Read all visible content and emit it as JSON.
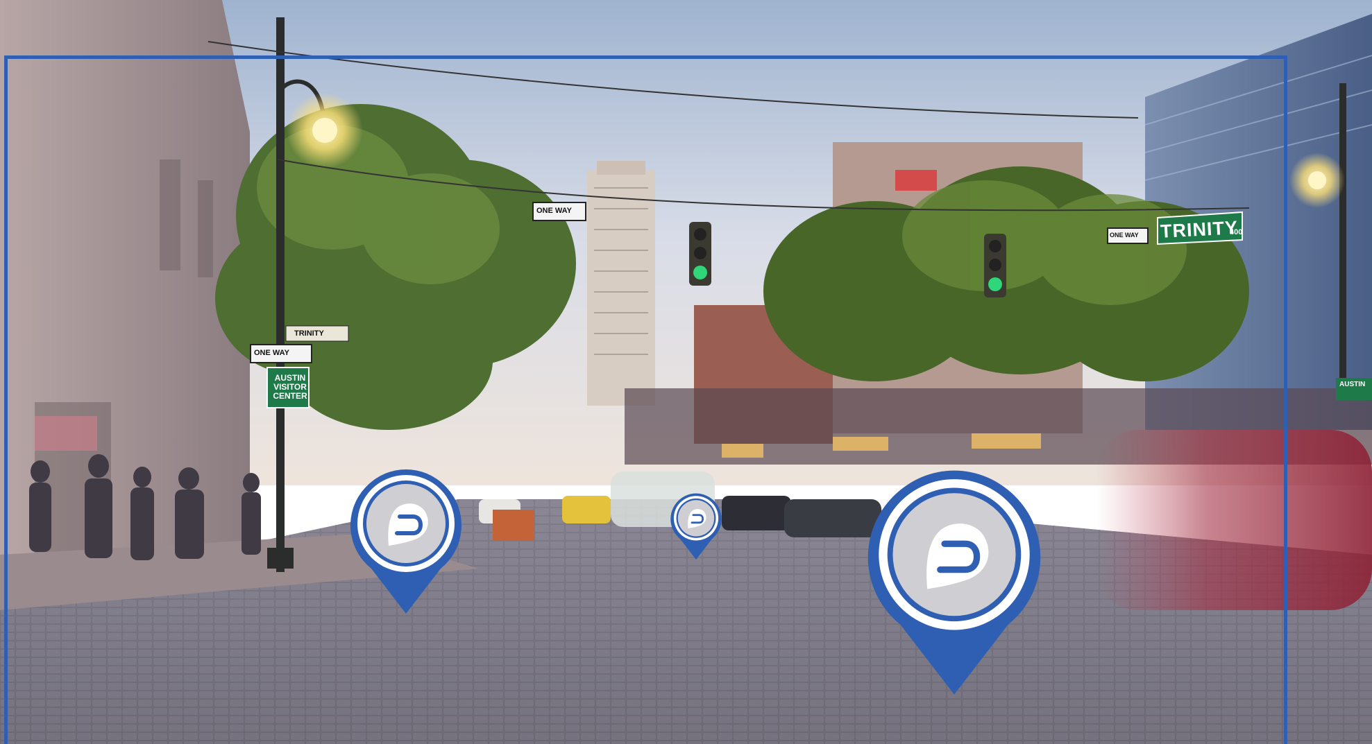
{
  "scene": {
    "street_sign_trinity": "TRINITY",
    "street_sign_trinity_number": "400",
    "street_sign_trinity_small": "TRINITY",
    "oneway_sign_text": "ONE WAY",
    "visitor_center_sign": "AUSTIN VISITOR CENTER",
    "visitor_center_sign_right": "AUSTIN"
  },
  "pins": [
    {
      "id": "pin-left",
      "icon": "parking-p-icon"
    },
    {
      "id": "pin-center",
      "icon": "parking-p-icon"
    },
    {
      "id": "pin-right",
      "icon": "parking-p-icon"
    }
  ],
  "colors": {
    "pin_blue": "#2f5fb3",
    "pin_ring": "#ffffff",
    "pin_inner": "#c9c9cc",
    "frame_border": "#2f5fb3",
    "sign_green": "#1f7a4a"
  }
}
